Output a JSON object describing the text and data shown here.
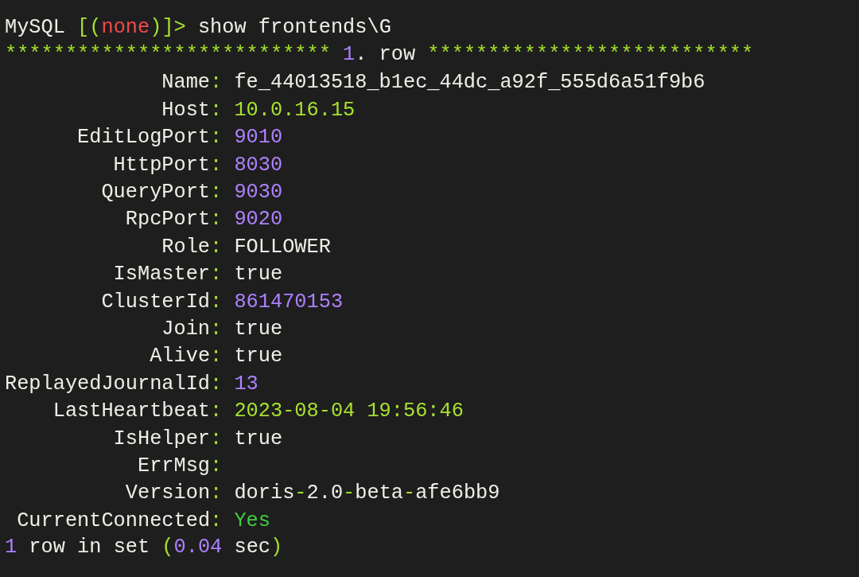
{
  "prompt": [
    {
      "text": "MySQL ",
      "kind": "plain"
    },
    {
      "text": "[(",
      "kind": "accent"
    },
    {
      "text": "none",
      "kind": "error"
    },
    {
      "text": ")]>",
      "kind": "accent"
    },
    {
      "text": " show frontends\\G",
      "kind": "plain"
    }
  ],
  "row_header": [
    {
      "text": "*************************** ",
      "kind": "accent"
    },
    {
      "text": "1",
      "kind": "number"
    },
    {
      "text": ". row ",
      "kind": "plain"
    },
    {
      "text": "***************************",
      "kind": "accent"
    }
  ],
  "fields": [
    {
      "label": "Name",
      "separator": ":",
      "value": [
        {
          "text": "fe_44013518_b1ec_44dc_a92f_555d6a51f9b6",
          "kind": "plain"
        }
      ]
    },
    {
      "label": "Host",
      "separator": ":",
      "value": [
        {
          "text": "10.0.16.15",
          "kind": "accent"
        }
      ]
    },
    {
      "label": "EditLogPort",
      "separator": ":",
      "value": [
        {
          "text": "9010",
          "kind": "number"
        }
      ]
    },
    {
      "label": "HttpPort",
      "separator": ":",
      "value": [
        {
          "text": "8030",
          "kind": "number"
        }
      ]
    },
    {
      "label": "QueryPort",
      "separator": ":",
      "value": [
        {
          "text": "9030",
          "kind": "number"
        }
      ]
    },
    {
      "label": "RpcPort",
      "separator": ":",
      "value": [
        {
          "text": "9020",
          "kind": "number"
        }
      ]
    },
    {
      "label": "Role",
      "separator": ":",
      "value": [
        {
          "text": "FOLLOWER",
          "kind": "plain"
        }
      ]
    },
    {
      "label": "IsMaster",
      "separator": ":",
      "value": [
        {
          "text": "true",
          "kind": "plain"
        }
      ]
    },
    {
      "label": "ClusterId",
      "separator": ":",
      "value": [
        {
          "text": "861470153",
          "kind": "number"
        }
      ]
    },
    {
      "label": "Join",
      "separator": ":",
      "value": [
        {
          "text": "true",
          "kind": "plain"
        }
      ]
    },
    {
      "label": "Alive",
      "separator": ":",
      "value": [
        {
          "text": "true",
          "kind": "plain"
        }
      ]
    },
    {
      "label": "ReplayedJournalId",
      "separator": ":",
      "value": [
        {
          "text": "13",
          "kind": "number"
        }
      ]
    },
    {
      "label": "LastHeartbeat",
      "separator": ":",
      "value": [
        {
          "text": "2023-08-04 19:56:46",
          "kind": "accent"
        }
      ]
    },
    {
      "label": "IsHelper",
      "separator": ":",
      "value": [
        {
          "text": "true",
          "kind": "plain"
        }
      ]
    },
    {
      "label": "ErrMsg",
      "separator": ":"
    },
    {
      "label": "Version",
      "separator": ":",
      "value": [
        {
          "text": "doris",
          "kind": "plain"
        },
        {
          "text": "-",
          "kind": "accent"
        },
        {
          "text": "2.0",
          "kind": "plain"
        },
        {
          "text": "-",
          "kind": "accent"
        },
        {
          "text": "beta",
          "kind": "plain"
        },
        {
          "text": "-",
          "kind": "accent"
        },
        {
          "text": "afe6bb9",
          "kind": "plain"
        }
      ]
    },
    {
      "label": "CurrentConnected",
      "separator": ":",
      "value": [
        {
          "text": "Yes",
          "kind": "ok"
        }
      ]
    }
  ],
  "footer": [
    {
      "text": "1",
      "kind": "number"
    },
    {
      "text": " row in set ",
      "kind": "plain"
    },
    {
      "text": "(",
      "kind": "accent"
    },
    {
      "text": "0.04",
      "kind": "number"
    },
    {
      "text": " sec",
      "kind": "plain"
    },
    {
      "text": ")",
      "kind": "accent"
    }
  ]
}
